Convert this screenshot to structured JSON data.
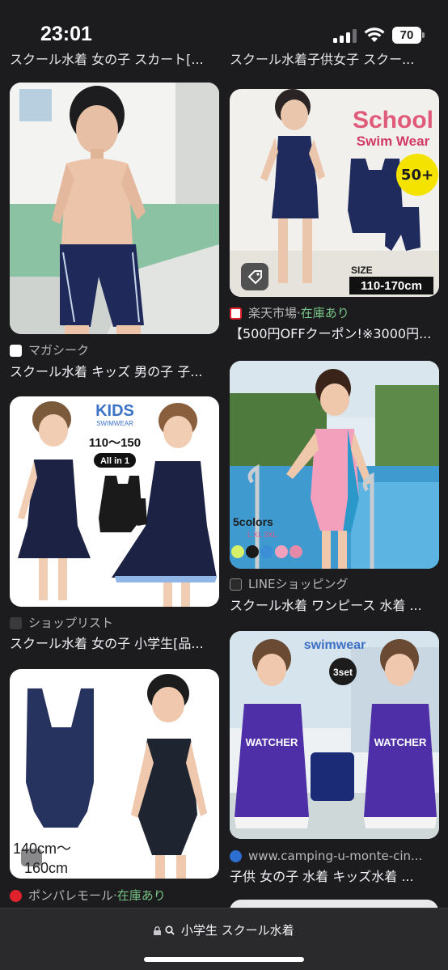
{
  "status_bar": {
    "time": "23:01",
    "battery": "70"
  },
  "top_cut_captions": {
    "left": "スクール水着 女の子 スカート[...",
    "right": "スクール水着子供女子 スクー..."
  },
  "results": [
    {
      "source": "マガシーク",
      "stock": "",
      "caption": "スクール水着 キッズ 男の子 子...",
      "favicon_color": "#ffffff"
    },
    {
      "source": "楽天市場",
      "separator": " · ",
      "stock": "在庫あり",
      "caption": "【500円OFFクーポン!※3000円...",
      "favicon_color": "#e0222d",
      "image_text": {
        "title_line1": "School",
        "title_line2": "Swim Wear",
        "badge": "50+",
        "size_label": "SIZE",
        "size_range": "110-170cm"
      }
    },
    {
      "source": "ショップリスト",
      "stock": "",
      "caption": "スクール水着 女の子 小学生[品...",
      "favicon_color": "#3a3a3c",
      "image_text": {
        "brand_top": "KIDS",
        "brand_sub": "SWIMWEAR",
        "size_range": "110～150",
        "allin": "All in 1"
      }
    },
    {
      "source": "LINEショッピング",
      "stock": "",
      "caption": "スクール水着 ワンピース 水着 ...",
      "favicon_color": "#2b2b2b",
      "image_text": {
        "colors": "5colors",
        "sizes": "L XL 3XL"
      }
    },
    {
      "source": "ポンパレモール",
      "separator": " · ",
      "stock": "在庫あり",
      "caption": "",
      "favicon_color": "#e0222d",
      "image_text": {
        "size_line1": "140cm～",
        "size_line2": "160cm"
      }
    },
    {
      "source": "www.camping-u-monte-cin...",
      "stock": "",
      "caption": "子供 女の子 水着 キッズ水着 ...",
      "favicon_color": "#2c6fd1",
      "image_text": {
        "brand": "swimwear",
        "set": "3set",
        "shirt": "WATCHER"
      }
    }
  ],
  "address_bar": {
    "query": "小学生 スクール水着"
  }
}
